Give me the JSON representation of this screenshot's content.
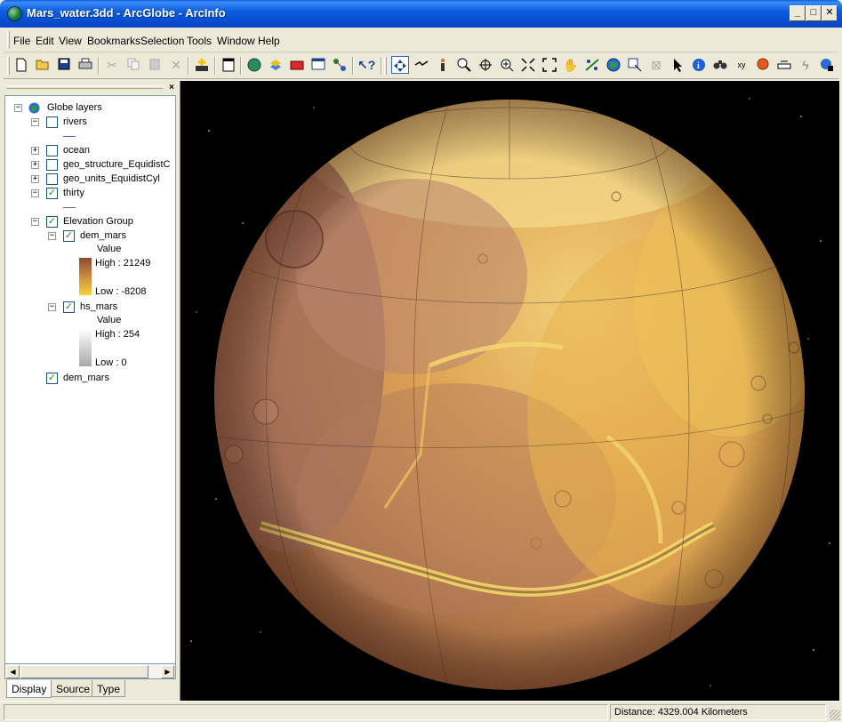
{
  "window": {
    "title": "Mars_water.3dd - ArcGlobe - ArcInfo",
    "minimize": "_",
    "maximize": "□",
    "close": "✕"
  },
  "menu": [
    "File",
    "Edit",
    "View",
    "Bookmarks",
    "Selection",
    "Tools",
    "Window",
    "Help"
  ],
  "toolbar_icons": [
    "new-icon",
    "open-icon",
    "save-icon",
    "print-icon",
    "cut-icon",
    "copy-icon",
    "paste-icon",
    "delete-icon",
    "add-data-icon",
    "table-icon",
    "globe-icon",
    "layers-icon",
    "toolbox-icon",
    "window-icon",
    "scene-icon",
    "whats-this-icon",
    "navigate-icon",
    "fly-icon",
    "observer-icon",
    "zoom-in-out-icon",
    "target-icon",
    "center-icon",
    "full-extent-icon",
    "extent-icon",
    "pan-icon",
    "swap-icon",
    "globe-full-icon",
    "effects-icon",
    "select-box-icon",
    "select-arrow-icon",
    "identify-icon",
    "find-icon",
    "goto-xy-icon",
    "sun-icon",
    "measure-icon",
    "lightning-icon",
    "globe-status-icon"
  ],
  "toc": {
    "close": "×",
    "nodes": [
      {
        "label": "Globe layers",
        "expander": "−",
        "checked": null,
        "legend": null
      },
      {
        "label": "rivers",
        "expander": "−",
        "checked": false,
        "legend": "line-blue"
      },
      {
        "label": "ocean",
        "expander": "+",
        "checked": false,
        "legend": null
      },
      {
        "label": "geo_structure_EquidistC",
        "expander": "+",
        "checked": false,
        "legend": null
      },
      {
        "label": "geo_units_EquidistCyl",
        "expander": "+",
        "checked": false,
        "legend": null
      },
      {
        "label": "thirty",
        "expander": "−",
        "checked": true,
        "legend": "line-gray"
      },
      {
        "label": "Elevation Group",
        "expander": "−",
        "checked": true,
        "legend": null
      },
      {
        "label": "dem_mars",
        "expander": "−",
        "checked": true,
        "legend": null
      },
      {
        "label": "hs_mars",
        "expander": "−",
        "checked": true,
        "legend": null
      },
      {
        "label": "dem_mars",
        "expander": null,
        "checked": true,
        "legend": null
      }
    ],
    "dem_legend": {
      "heading": "Value",
      "high": "High : 21249",
      "low": "Low : -8208",
      "ramp": [
        "#8a4a2e",
        "#c8862f",
        "#f5d53a"
      ]
    },
    "hs_legend": {
      "heading": "Value",
      "high": "High : 254",
      "low": "Low : 0",
      "ramp": [
        "#ffffff",
        "#a8a8a8"
      ]
    },
    "tabs": [
      "Display",
      "Source",
      "Type"
    ],
    "active_tab": "Display",
    "scroll_left": "◀",
    "scroll_right": "▶"
  },
  "status": {
    "distance": "Distance:  4329.004 Kilometers"
  },
  "colors": {
    "title_blue": "#0553d2",
    "mars_light": "#f3d27a",
    "mars_mid": "#d69a4c",
    "mars_dark": "#9c6a55",
    "space": "#000000"
  }
}
